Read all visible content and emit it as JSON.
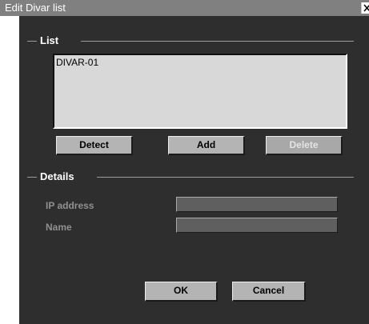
{
  "window": {
    "title": "Edit Divar list"
  },
  "list_section": {
    "heading": "List",
    "items": [
      "DIVAR-01"
    ]
  },
  "buttons": {
    "detect": "Detect",
    "add": "Add",
    "delete": "Delete",
    "delete_enabled": false,
    "ok": "OK",
    "cancel": "Cancel"
  },
  "details_section": {
    "heading": "Details",
    "ip_label": "IP address",
    "ip_value": "",
    "name_label": "Name",
    "name_value": ""
  },
  "icons": {
    "close": "close-icon"
  },
  "colors": {
    "background": "#2e2e2e",
    "titlebar": "#808080",
    "list_background": "#d8d8d8",
    "button_face": "#b4b4b4",
    "field_background": "#5f5f5f",
    "label_gray": "#909090"
  }
}
